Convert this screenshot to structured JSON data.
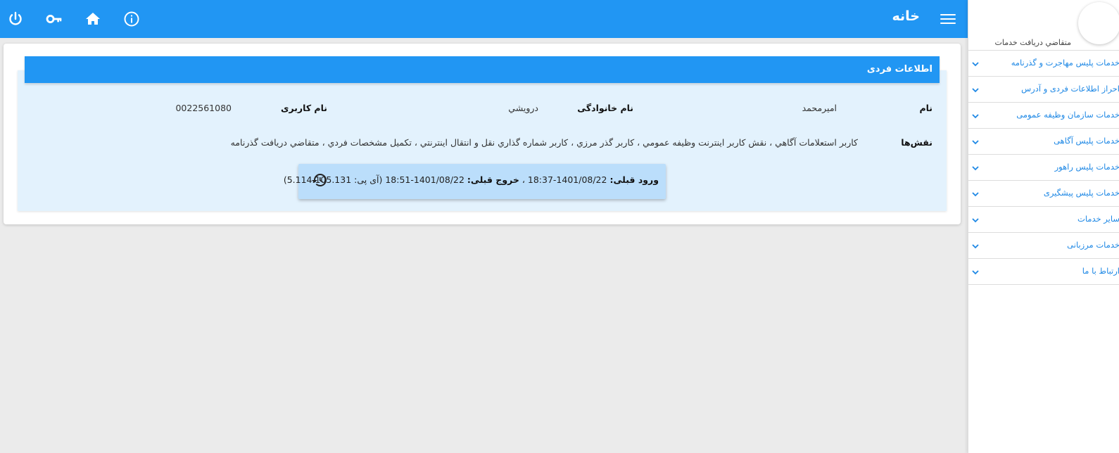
{
  "header": {
    "title": "خانه",
    "icons": [
      "menu-icon",
      "info-icon",
      "home-icon",
      "key-icon",
      "power-icon"
    ]
  },
  "profile": {
    "section_title": "اطلاعات فردی",
    "name_label": "نام",
    "name_value": "اميرمحمد",
    "family_label": "نام خانوادگی",
    "family_value": "درويشي",
    "username_label": "نام کاربری",
    "username_value": "0022561080",
    "roles_label": "نقش‌ها",
    "roles_value": "کاربر استعلامات آگاهي ، نقش کاربر اينترنت وظيفه عمومي ، کاربر گذر مرزي ، کاربر شماره گذاري نقل و انتقال اينترنتي ، تکميل مشخصات فردي ، متقاضي دريافت گذرنامه"
  },
  "login": {
    "prev_login_label": "ورود قبلی:",
    "prev_login_value": "1401/08/22-18:37 ،",
    "prev_logout_label": "خروج قبلی:",
    "prev_logout_value": "1401/08/22-18:51",
    "ip_text": "(آی پی: 5.114.105.131)"
  },
  "sidebar": {
    "user_role": "متقاضي دريافت خدمات",
    "items": [
      {
        "label": "خدمات پلیس مهاجرت و گذرنامه"
      },
      {
        "label": "احراز اطلاعات فردی و آدرس"
      },
      {
        "label": "خدمات سازمان وظیفه عمومی"
      },
      {
        "label": "خدمات پلیس آگاهی"
      },
      {
        "label": "خدمات پلیس راهور"
      },
      {
        "label": "خدمات پلیس پیشگیری"
      },
      {
        "label": "سایر خدمات"
      },
      {
        "label": "خدمات مرزبانی"
      },
      {
        "label": "ارتباط با ما"
      }
    ]
  },
  "colors": {
    "primary": "#2196f3",
    "panel": "#e3f2fd",
    "login_box": "#bbdefb",
    "link": "#1e88e5"
  }
}
